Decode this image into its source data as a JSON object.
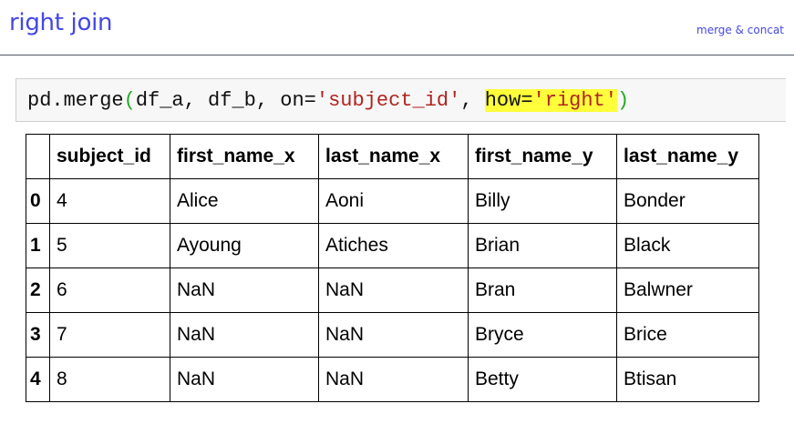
{
  "header": {
    "title": "right join",
    "link": "merge & concat"
  },
  "code": {
    "prefix": "pd.merge",
    "open_paren": "(",
    "args": "df_a, df_b, on=",
    "on_value": "'subject_id'",
    "separator": ", ",
    "how_key": "how=",
    "how_value": "'right'",
    "close_paren": ")"
  },
  "table": {
    "columns": [
      "",
      "subject_id",
      "first_name_x",
      "last_name_x",
      "first_name_y",
      "last_name_y"
    ],
    "rows": [
      {
        "index": "0",
        "cells": [
          "4",
          "Alice",
          "Aoni",
          "Billy",
          "Bonder"
        ]
      },
      {
        "index": "1",
        "cells": [
          "5",
          "Ayoung",
          "Atiches",
          "Brian",
          "Black"
        ]
      },
      {
        "index": "2",
        "cells": [
          "6",
          "NaN",
          "NaN",
          "Bran",
          "Balwner"
        ]
      },
      {
        "index": "3",
        "cells": [
          "7",
          "NaN",
          "NaN",
          "Bryce",
          "Brice"
        ]
      },
      {
        "index": "4",
        "cells": [
          "8",
          "NaN",
          "NaN",
          "Betty",
          "Btisan"
        ]
      }
    ]
  }
}
